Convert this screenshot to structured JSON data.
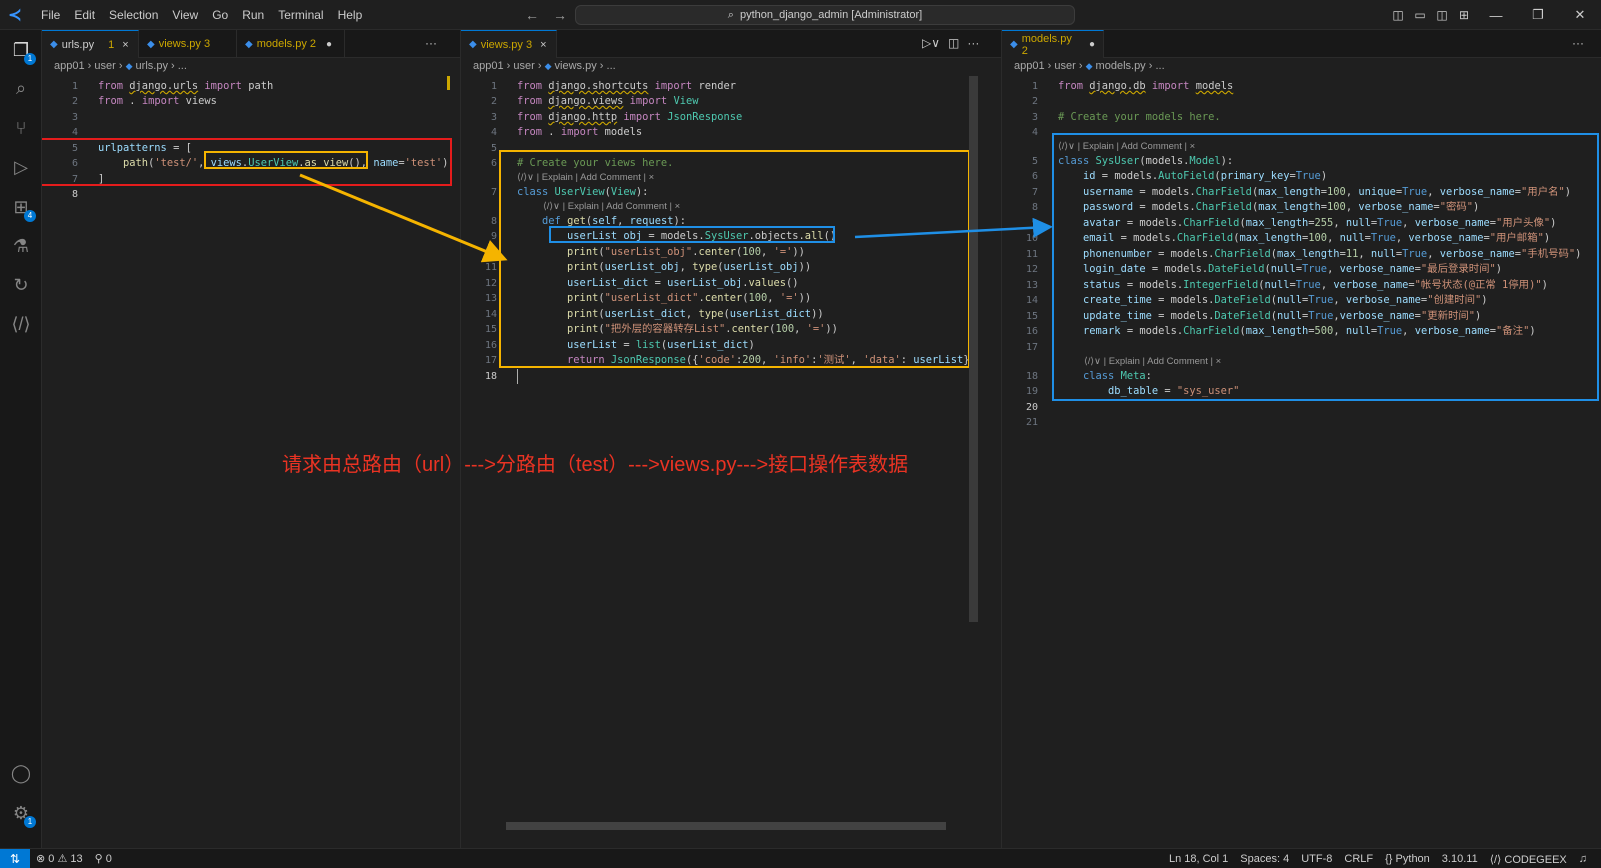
{
  "menu": [
    "File",
    "Edit",
    "Selection",
    "View",
    "Go",
    "Run",
    "Terminal",
    "Help"
  ],
  "search": {
    "text": "python_django_admin [Administrator]"
  },
  "panes": {
    "left": {
      "tabs": [
        {
          "label": "urls.py",
          "count": "1",
          "close": "×"
        },
        {
          "label": "views.py 3",
          "count": "",
          "close": ""
        },
        {
          "label": "models.py 2",
          "count": "",
          "close": "●"
        }
      ],
      "tab_more": "···",
      "breadcrumb": [
        "app01",
        "user",
        "urls.py",
        "..."
      ]
    },
    "middle": {
      "tabs": [
        {
          "label": "views.py 3",
          "close": "×"
        }
      ],
      "tab_more": "···",
      "breadcrumb": [
        "app01",
        "user",
        "views.py",
        "..."
      ]
    },
    "right": {
      "tabs": [
        {
          "label": "models.py 2",
          "close": "●"
        }
      ],
      "tab_more": "···",
      "breadcrumb": [
        "app01",
        "user",
        "models.py",
        "..."
      ]
    }
  },
  "codelens": "⟨/⟩∨ | Explain | Add Comment | ×",
  "urls_code": [
    {
      "n": "1",
      "t": "from django.urls import path"
    },
    {
      "n": "2",
      "t": "from . import views"
    },
    {
      "n": "3",
      "t": ""
    },
    {
      "n": "4",
      "t": ""
    },
    {
      "n": "5",
      "t": "urlpatterns = ["
    },
    {
      "n": "6",
      "t": "    path('test/', views.UserView.as_view(), name='test')"
    },
    {
      "n": "7",
      "t": "]"
    },
    {
      "n": "8",
      "t": ""
    }
  ],
  "views_code": [
    {
      "n": "1",
      "t": "from django.shortcuts import render"
    },
    {
      "n": "2",
      "t": "from django.views import View"
    },
    {
      "n": "3",
      "t": "from django.http import JsonResponse"
    },
    {
      "n": "4",
      "t": "from . import models"
    },
    {
      "n": "5",
      "t": ""
    },
    {
      "n": "6",
      "t": "# Create your views here."
    },
    {
      "n": "7",
      "t": "class UserView(View):"
    },
    {
      "n": "8",
      "t": "    def get(self, request):"
    },
    {
      "n": "9",
      "t": "        userList_obj = models.SysUser.objects.all()"
    },
    {
      "n": "10",
      "t": "        print(\"userList_obj\".center(100, '='))"
    },
    {
      "n": "11",
      "t": "        print(userList_obj, type(userList_obj))"
    },
    {
      "n": "12",
      "t": "        userList_dict = userList_obj.values()"
    },
    {
      "n": "13",
      "t": "        print(\"userList_dict\".center(100, '='))"
    },
    {
      "n": "14",
      "t": "        print(userList_dict, type(userList_dict))"
    },
    {
      "n": "15",
      "t": "        print(\"把外层的容器转存List\".center(100, '='))"
    },
    {
      "n": "16",
      "t": "        userList = list(userList_dict)"
    },
    {
      "n": "17",
      "t": "        return JsonResponse({'code':200, 'info':'测试', 'data': userList})"
    },
    {
      "n": "18",
      "t": ""
    }
  ],
  "models_code": [
    {
      "n": "1",
      "t": "from django.db import models"
    },
    {
      "n": "2",
      "t": ""
    },
    {
      "n": "3",
      "t": "# Create your models here."
    },
    {
      "n": "4",
      "t": ""
    },
    {
      "n": "5",
      "t": "class SysUser(models.Model):"
    },
    {
      "n": "6",
      "t": "    id = models.AutoField(primary_key=True)"
    },
    {
      "n": "7",
      "t": "    username = models.CharField(max_length=100, unique=True, verbose_name=\"用户名\")"
    },
    {
      "n": "8",
      "t": "    password = models.CharField(max_length=100, verbose_name=\"密码\")"
    },
    {
      "n": "9",
      "t": "    avatar = models.CharField(max_length=255, null=True, verbose_name=\"用户头像\")"
    },
    {
      "n": "10",
      "t": "    email = models.CharField(max_length=100, null=True, verbose_name=\"用户邮箱\")"
    },
    {
      "n": "11",
      "t": "    phonenumber = models.CharField(max_length=11, null=True, verbose_name=\"手机号码\")"
    },
    {
      "n": "12",
      "t": "    login_date = models.DateField(null=True, verbose_name=\"最后登录时间\")"
    },
    {
      "n": "13",
      "t": "    status = models.IntegerField(null=True, verbose_name=\"帐号状态(@正常 1停用)\")"
    },
    {
      "n": "14",
      "t": "    create_time = models.DateField(null=True, verbose_name=\"创建时间\")"
    },
    {
      "n": "15",
      "t": "    update_time = models.DateField(null=True,verbose_name=\"更新时间\")"
    },
    {
      "n": "16",
      "t": "    remark = models.CharField(max_length=500, null=True, verbose_name=\"备注\")"
    },
    {
      "n": "17",
      "t": ""
    },
    {
      "n": "18",
      "t": "    class Meta:"
    },
    {
      "n": "19",
      "t": "        db_table = \"sys_user\""
    },
    {
      "n": "20",
      "t": ""
    },
    {
      "n": "21",
      "t": ""
    }
  ],
  "annotation": "请求由总路由（url）--->分路由（test）--->views.py--->接口操作表数据",
  "status": {
    "errors": "0",
    "warnings": "13",
    "ports": "0",
    "position": "Ln 18, Col 1",
    "spaces": "Spaces: 4",
    "encoding": "UTF-8",
    "eol": "CRLF",
    "language": "Python",
    "version": "3.10.11",
    "ext": "CODEGEEX"
  },
  "colors": {
    "red_box": "#e51c1c",
    "yellow_box": "#f5b400",
    "blue_box": "#1f8fe6",
    "annotation": "#ea3323",
    "accent": "#0078d4"
  }
}
